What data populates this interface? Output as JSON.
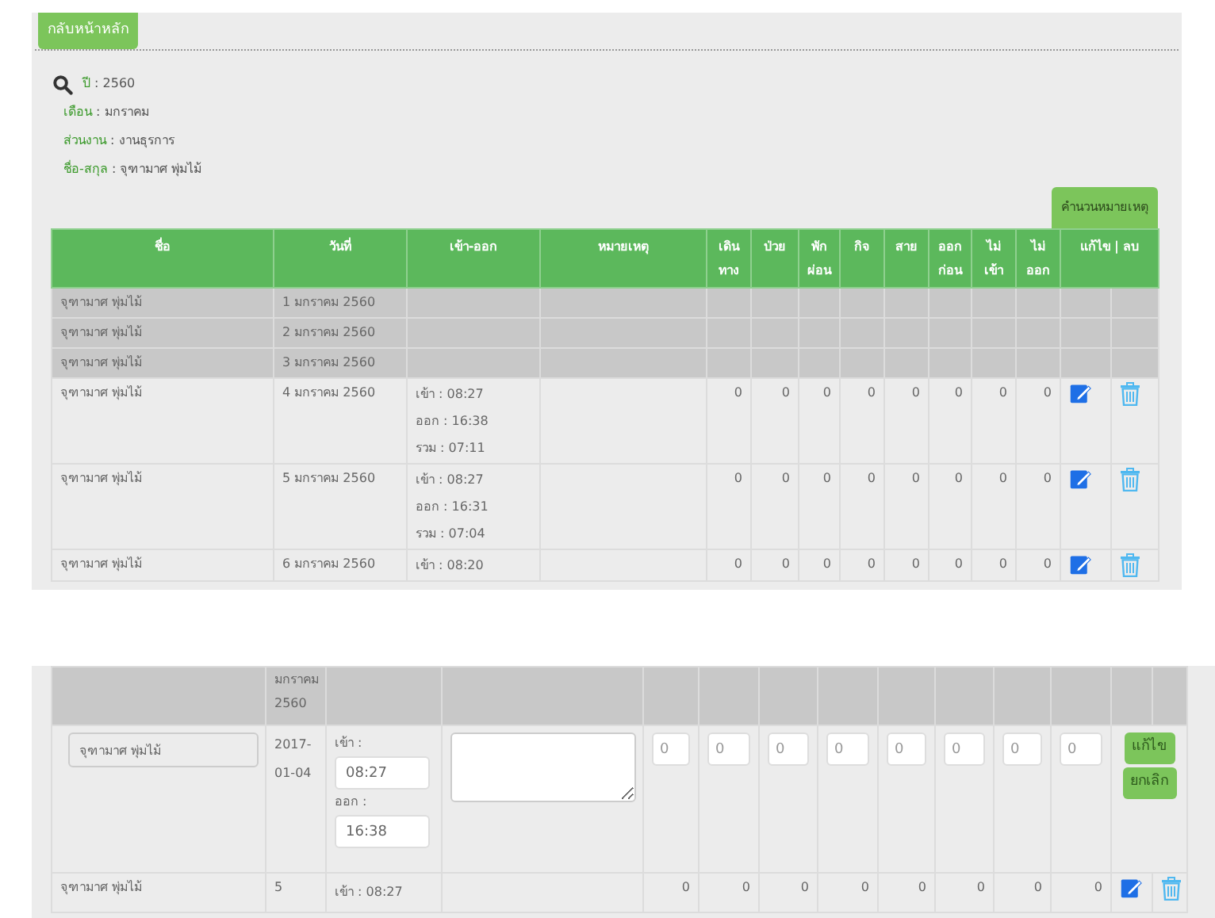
{
  "back_button": "กลับหน้าหลัก",
  "filters": [
    {
      "label": "ปี",
      "value": ": 2560"
    },
    {
      "label": "เดือน",
      "value": ": มกราคม"
    },
    {
      "label": "ส่วนงาน",
      "value": ": งานธุรการ"
    },
    {
      "label": "ชื่อ-สกุล",
      "value": ": จุฑามาศ พุ่มไม้"
    }
  ],
  "calc_button": "คำนวนหมายเหตุ",
  "table": {
    "columns": [
      "ชื่อ",
      "วันที่",
      "เข้า-ออก",
      "หมายเหตุ",
      "เดิน ทาง",
      "ป่วย",
      "พัก ผ่อน",
      "กิจ",
      "สาย",
      "ออก ก่อน",
      "ไม่ เข้า",
      "ไม่ ออก",
      "แก้ไข | ลบ"
    ],
    "rows": [
      {
        "kind": "holiday",
        "name": "จุฑามาศ พุ่มไม้",
        "date": "1 มกราคม 2560"
      },
      {
        "kind": "holiday",
        "name": "จุฑามาศ พุ่มไม้",
        "date": "2 มกราคม 2560"
      },
      {
        "kind": "holiday",
        "name": "จุฑามาศ พุ่มไม้",
        "date": "3 มกราคม 2560"
      },
      {
        "kind": "record",
        "name": "จุฑามาศ พุ่มไม้",
        "date": "4 มกราคม 2560",
        "times": [
          "เข้า : 08:27",
          "ออก : 16:38",
          "รวม : 07:11"
        ],
        "counts": [
          "0",
          "0",
          "0",
          "0",
          "0",
          "0",
          "0",
          "0"
        ]
      },
      {
        "kind": "record",
        "name": "จุฑามาศ พุ่มไม้",
        "date": "5 มกราคม 2560",
        "times": [
          "เข้า : 08:27",
          "ออก : 16:31",
          "รวม : 07:04"
        ],
        "counts": [
          "0",
          "0",
          "0",
          "0",
          "0",
          "0",
          "0",
          "0"
        ]
      },
      {
        "kind": "record",
        "name": "จุฑามาศ พุ่มไม้",
        "date": "6 มกราคม 2560",
        "times": [
          "เข้า : 08:20"
        ],
        "counts": [
          "0",
          "0",
          "0",
          "0",
          "0",
          "0",
          "0",
          "0"
        ]
      }
    ]
  },
  "edit_view": {
    "rows": [
      {
        "kind": "holiday",
        "date_lines": [
          "มกราคม",
          "2560"
        ]
      },
      {
        "kind": "editing",
        "name": "จุฑามาศ พุ่มไม้",
        "date": "2017-01-04",
        "in_label": "เข้า :",
        "in_value": "08:27",
        "out_label": "ออก :",
        "out_value": "16:38",
        "counts": [
          "0",
          "0",
          "0",
          "0",
          "0",
          "0",
          "0",
          "0"
        ],
        "buttons": [
          "แก้ไข",
          "ยกเลิก"
        ]
      },
      {
        "kind": "record",
        "name": "จุฑามาศ พุ่มไม้",
        "date": "5",
        "times": [
          "เข้า : 08:27"
        ],
        "counts": [
          "0",
          "0",
          "0",
          "0",
          "0",
          "0",
          "0",
          "0"
        ]
      }
    ]
  }
}
